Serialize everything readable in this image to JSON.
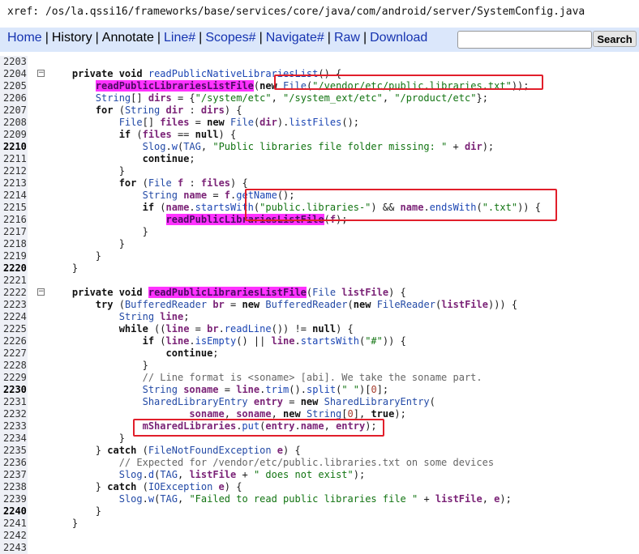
{
  "xref": "xref: /os/la.qssi16/frameworks/base/services/core/java/com/android/server/SystemConfig.java",
  "nav": {
    "home": "Home",
    "history": "History",
    "annotate": "Annotate",
    "line": "Line#",
    "scopes": "Scopes#",
    "navigate": "Navigate#",
    "raw": "Raw",
    "download": "Download",
    "search_button": "Search",
    "search_value": ""
  },
  "colors": {
    "nav_bg": "#dbe7fb",
    "highlight": "#ff33ff",
    "annotation_box": "#e11f2b",
    "link": "#1533b0"
  },
  "fold_glyph": "⊟",
  "lines": [
    {
      "n": "2203",
      "b": false,
      "fold": false,
      "html": ""
    },
    {
      "n": "2204",
      "b": false,
      "fold": true,
      "html": "    <span class=\"kw\">private void</span> <span class=\"fn\">readPublicNativeLibrariesList</span>() {"
    },
    {
      "n": "2205",
      "b": false,
      "fold": false,
      "html": "        <span class=\"hl\">readPublicLibrariesListFile</span>(<span class=\"kw\">new</span> <span class=\"ty\">File</span>(<span class=\"str\">\"/vendor/etc/public.libraries.txt\"</span>));"
    },
    {
      "n": "2206",
      "b": false,
      "fold": false,
      "html": "        <span class=\"ty\">String</span>[] <span class=\"id\">dirs</span> = {<span class=\"str\">\"/system/etc\"</span>, <span class=\"str\">\"/system_ext/etc\"</span>, <span class=\"str\">\"/product/etc\"</span>};"
    },
    {
      "n": "2207",
      "b": false,
      "fold": false,
      "html": "        <span class=\"kw\">for</span> (<span class=\"ty\">String</span> <span class=\"id\">dir</span> : <span class=\"id\">dirs</span>) {"
    },
    {
      "n": "2208",
      "b": false,
      "fold": false,
      "html": "            <span class=\"ty\">File</span>[] <span class=\"id\">files</span> = <span class=\"kw\">new</span> <span class=\"ty\">File</span>(<span class=\"id\">dir</span>).<span class=\"fn\">listFiles</span>();"
    },
    {
      "n": "2209",
      "b": false,
      "fold": false,
      "html": "            <span class=\"kw\">if</span> (<span class=\"id\">files</span> == <span class=\"kw\">null</span>) {"
    },
    {
      "n": "2210",
      "b": true,
      "fold": false,
      "html": "                <span class=\"ty\">Slog</span>.<span class=\"fn\">w</span>(<span class=\"ty\">TAG</span>, <span class=\"str\">\"Public libraries file folder missing: \"</span> + <span class=\"id\">dir</span>);"
    },
    {
      "n": "2211",
      "b": false,
      "fold": false,
      "html": "                <span class=\"kw\">continue</span>;"
    },
    {
      "n": "2212",
      "b": false,
      "fold": false,
      "html": "            }"
    },
    {
      "n": "2213",
      "b": false,
      "fold": false,
      "html": "            <span class=\"kw\">for</span> (<span class=\"ty\">File</span> <span class=\"id\">f</span> : <span class=\"id\">files</span>) {"
    },
    {
      "n": "2214",
      "b": false,
      "fold": false,
      "html": "                <span class=\"ty\">String</span> <span class=\"id\">name</span> = <span class=\"id\">f</span>.<span class=\"fn\">getName</span>();"
    },
    {
      "n": "2215",
      "b": false,
      "fold": false,
      "html": "                <span class=\"kw\">if</span> (<span class=\"id\">name</span>.<span class=\"fn\">startsWith</span>(<span class=\"str\">\"public.libraries-\"</span>) &amp;&amp; <span class=\"id\">name</span>.<span class=\"fn\">endsWith</span>(<span class=\"str\">\".txt\"</span>)) {"
    },
    {
      "n": "2216",
      "b": false,
      "fold": false,
      "html": "                    <span class=\"hl\">readPublicLibrariesListFile</span>(<span class=\"id\">f</span>);"
    },
    {
      "n": "2217",
      "b": false,
      "fold": false,
      "html": "                }"
    },
    {
      "n": "2218",
      "b": false,
      "fold": false,
      "html": "            }"
    },
    {
      "n": "2219",
      "b": false,
      "fold": false,
      "html": "        }"
    },
    {
      "n": "2220",
      "b": true,
      "fold": false,
      "html": "    }"
    },
    {
      "n": "2221",
      "b": false,
      "fold": false,
      "html": ""
    },
    {
      "n": "2222",
      "b": false,
      "fold": true,
      "html": "    <span class=\"kw\">private void</span> <span class=\"hl\">readPublicLibrariesListFile</span>(<span class=\"ty\">File</span> <span class=\"id\">listFile</span>) {"
    },
    {
      "n": "2223",
      "b": false,
      "fold": false,
      "html": "        <span class=\"kw\">try</span> (<span class=\"ty\">BufferedReader</span> <span class=\"id\">br</span> = <span class=\"kw\">new</span> <span class=\"ty\">BufferedReader</span>(<span class=\"kw\">new</span> <span class=\"ty\">FileReader</span>(<span class=\"id\">listFile</span>))) {"
    },
    {
      "n": "2224",
      "b": false,
      "fold": false,
      "html": "            <span class=\"ty\">String</span> <span class=\"id\">line</span>;"
    },
    {
      "n": "2225",
      "b": false,
      "fold": false,
      "html": "            <span class=\"kw\">while</span> ((<span class=\"id\">line</span> = <span class=\"id\">br</span>.<span class=\"fn\">readLine</span>()) != <span class=\"kw\">null</span>) {"
    },
    {
      "n": "2226",
      "b": false,
      "fold": false,
      "html": "                <span class=\"kw\">if</span> (<span class=\"id\">line</span>.<span class=\"fn\">isEmpty</span>() || <span class=\"id\">line</span>.<span class=\"fn\">startsWith</span>(<span class=\"str\">\"#\"</span>)) {"
    },
    {
      "n": "2227",
      "b": false,
      "fold": false,
      "html": "                    <span class=\"kw\">continue</span>;"
    },
    {
      "n": "2228",
      "b": false,
      "fold": false,
      "html": "                }"
    },
    {
      "n": "2229",
      "b": false,
      "fold": false,
      "html": "                <span class=\"cm\">// Line format is &lt;soname&gt; [abi]. We take the soname part.</span>"
    },
    {
      "n": "2230",
      "b": true,
      "fold": false,
      "html": "                <span class=\"ty\">String</span> <span class=\"id\">soname</span> = <span class=\"id\">line</span>.<span class=\"fn\">trim</span>().<span class=\"fn\">split</span>(<span class=\"str\">\" \"</span>)[<span class=\"num\">0</span>];"
    },
    {
      "n": "2231",
      "b": false,
      "fold": false,
      "html": "                <span class=\"ty\">SharedLibraryEntry</span> <span class=\"id\">entry</span> = <span class=\"kw\">new</span> <span class=\"ty\">SharedLibraryEntry</span>("
    },
    {
      "n": "2232",
      "b": false,
      "fold": false,
      "html": "                        <span class=\"id\">soname</span>, <span class=\"id\">soname</span>, <span class=\"kw\">new</span> <span class=\"ty\">String</span>[<span class=\"num\">0</span>], <span class=\"kw\">true</span>);"
    },
    {
      "n": "2233",
      "b": false,
      "fold": false,
      "html": "                <span class=\"id\">mSharedLibraries</span>.<span class=\"fn\">put</span>(<span class=\"id\">entry</span>.<span class=\"id\">name</span>, <span class=\"id\">entry</span>);"
    },
    {
      "n": "2234",
      "b": false,
      "fold": false,
      "html": "            }"
    },
    {
      "n": "2235",
      "b": false,
      "fold": false,
      "html": "        } <span class=\"kw\">catch</span> (<span class=\"ty\">FileNotFoundException</span> <span class=\"id\">e</span>) {"
    },
    {
      "n": "2236",
      "b": false,
      "fold": false,
      "html": "            <span class=\"cm\">// Expected for /vendor/etc/public.libraries.txt on some devices</span>"
    },
    {
      "n": "2237",
      "b": false,
      "fold": false,
      "html": "            <span class=\"ty\">Slog</span>.<span class=\"fn\">d</span>(<span class=\"ty\">TAG</span>, <span class=\"id\">listFile</span> + <span class=\"str\">\" does not exist\"</span>);"
    },
    {
      "n": "2238",
      "b": false,
      "fold": false,
      "html": "        } <span class=\"kw\">catch</span> (<span class=\"ty\">IOException</span> <span class=\"id\">e</span>) {"
    },
    {
      "n": "2239",
      "b": false,
      "fold": false,
      "html": "            <span class=\"ty\">Slog</span>.<span class=\"fn\">w</span>(<span class=\"ty\">TAG</span>, <span class=\"str\">\"Failed to read public libraries file \"</span> + <span class=\"id\">listFile</span>, <span class=\"id\">e</span>);"
    },
    {
      "n": "2240",
      "b": true,
      "fold": false,
      "html": "        }"
    },
    {
      "n": "2241",
      "b": false,
      "fold": false,
      "html": "    }"
    },
    {
      "n": "2242",
      "b": false,
      "fold": false,
      "html": ""
    },
    {
      "n": "2243",
      "b": false,
      "fold": false,
      "html": ""
    }
  ]
}
